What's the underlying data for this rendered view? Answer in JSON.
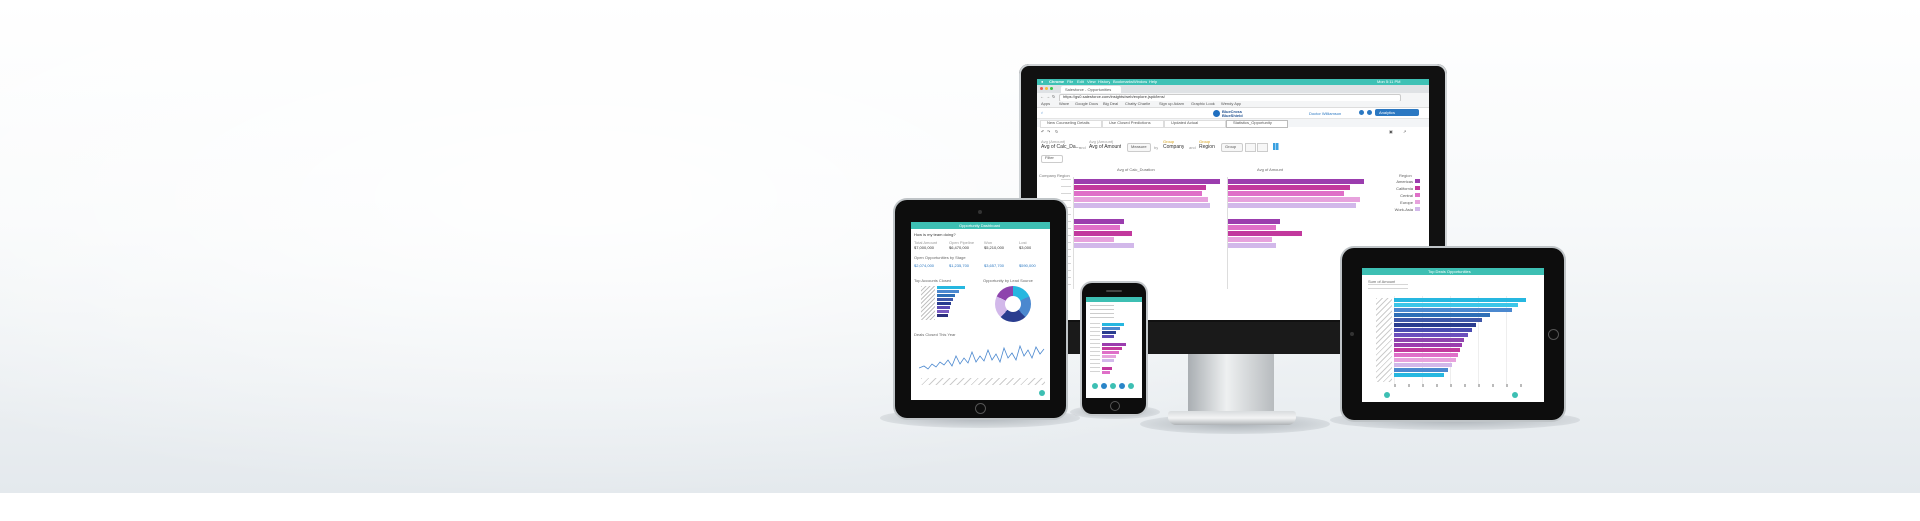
{
  "desktop": {
    "mac_menu": [
      "Chrome",
      "File",
      "Edit",
      "View",
      "History",
      "Bookmarks",
      "Window",
      "Help"
    ],
    "mac_clock": "Mon 5:11 PM",
    "browser_tab": "Salesforce - Opportunities",
    "address": "https://gs0.salesforce.com/insights/web/explore.jsp#/lens/",
    "bookmarks": [
      "Apps",
      "Wave",
      "Google Docs",
      "Big Deal",
      "Chatty Charlie",
      "Sign up Adam",
      "Graphic Look",
      "Wendy App"
    ],
    "brand_line1": "BlueCross",
    "brand_line2": "BlueShield",
    "user_name": "Doctor Williamson",
    "app_button": "Analytics",
    "app_tabs": [
      "New Counseling Details",
      "Use Closed Predictions",
      "Updated Actual",
      "Statistics_Opportunity"
    ],
    "query": {
      "measure_label_1": "Avg (Amount)",
      "measure_1": "Avg of Calc_Da...",
      "and_1": "and",
      "measure_label_2": "Avg (Amount)",
      "measure_2": "Avg of Amount",
      "measure_pill": "Measure",
      "by": "by",
      "group_label_1": "Group",
      "group_1": "Company",
      "and_2": "and",
      "group_label_2": "Group",
      "group_2": "Region",
      "group_pill": "Group",
      "filter": "Filter"
    },
    "chart_left_title": "Avg of Calc_Duration",
    "chart_right_title": "Avg of Amount",
    "axis_left": "Company",
    "axis_region": "Region",
    "legend_title": "Region",
    "legend": [
      "Americas",
      "California",
      "Central",
      "Europe",
      "Work-Asia"
    ]
  },
  "tablet_left": {
    "header": "Opportunity Dashboard",
    "question": "How is my team doing?",
    "kpi_labels": [
      "Total Amount",
      "Open Pipeline",
      "Won",
      "Lost"
    ],
    "kpi_values": [
      "$7,000,000",
      "$6,470,000",
      "$5,210,000",
      "$3,000"
    ],
    "section2": "Open Opportunities by Stage",
    "kpi2_values": [
      "$2,074,000",
      "$1,235,700",
      "$3,657,700",
      "$590,000"
    ],
    "panel_left": "Top Accounts Closed",
    "panel_right": "Opportunity by Lead Source",
    "panel_bottom": "Deals Closed This Year"
  },
  "tablet_right": {
    "header": "Top Deals Opportunities",
    "subtitle": "Sum of Amount"
  },
  "colors": {
    "teal": "#3dbfb3",
    "magenta": "#c2399d",
    "pink": "#df6fc8",
    "lavender": "#d2b8ea",
    "purple": "#8e44ad",
    "blue": "#4b88cf",
    "cyan": "#26b7e0"
  }
}
